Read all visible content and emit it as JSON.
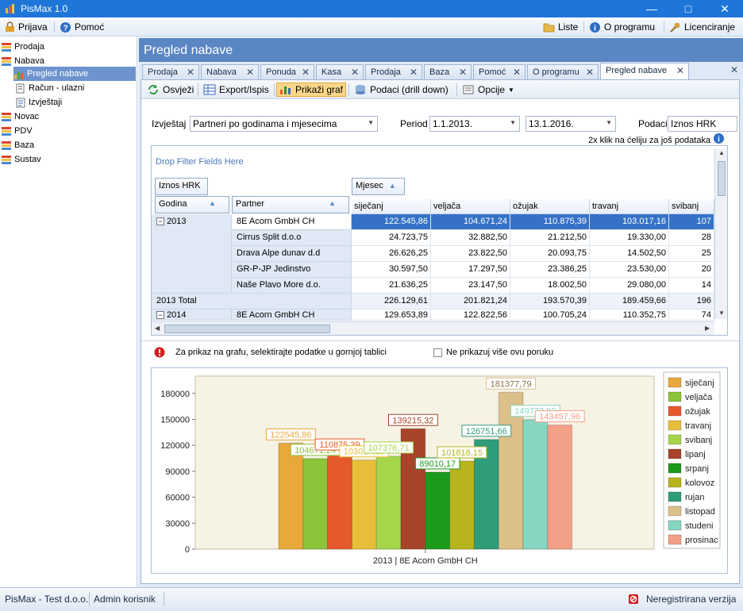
{
  "window": {
    "title": "PisMax 1.0"
  },
  "menu": {
    "prijava": "Prijava",
    "pomoc": "Pomoć",
    "liste": "Liste",
    "o_programu": "O programu",
    "licenciranje": "Licenciranje"
  },
  "nav": [
    {
      "label": "Prodaja",
      "level": 0
    },
    {
      "label": "Nabava",
      "level": 0
    },
    {
      "label": "Pregled nabave",
      "level": 1,
      "selected": true
    },
    {
      "label": "Račun - ulazni",
      "level": 1
    },
    {
      "label": "Izvještaji",
      "level": 1
    },
    {
      "label": "Novac",
      "level": 0
    },
    {
      "label": "PDV",
      "level": 0
    },
    {
      "label": "Baza",
      "level": 0
    },
    {
      "label": "Sustav",
      "level": 0
    }
  ],
  "panel": {
    "title": "Pregled nabave"
  },
  "tabs": [
    "Prodaja",
    "Nabava",
    "Ponuda",
    "Kasa",
    "Prodaja",
    "Baza",
    "Pomoć",
    "O programu",
    "Pregled nabave"
  ],
  "toolbar": {
    "osvjezi": "Osvježi",
    "export": "Export/Ispis",
    "graf": "Prikaži graf",
    "drill": "Podaci (drill down)",
    "opcije": "Opcije"
  },
  "filters": {
    "izvjestaj_label": "Izvještaj",
    "izvjestaj_value": "Partneri po godinama i mjesecima",
    "period_label": "Period",
    "period_from": "1.1.2013.",
    "period_to": "13.1.2016.",
    "podaci_label": "Podaci",
    "podaci_value": "Iznos HRK",
    "hint": "2x klik na ćeliju za još podataka"
  },
  "pivot": {
    "drop_filter": "Drop Filter Fields Here",
    "data_field": "Iznos HRK",
    "column_field": "Mjesec",
    "row_fields": [
      "Godina",
      "Partner"
    ],
    "months": [
      "siječanj",
      "veljača",
      "ožujak",
      "travanj",
      "svibanj"
    ],
    "rows": [
      {
        "year": "2013",
        "partner": "8E Acorn GmbH CH",
        "values": [
          "122.545,86",
          "104.671,24",
          "110.875,39",
          "103.017,16",
          "107"
        ]
      },
      {
        "partner": "Cirrus Split d.o.o",
        "values": [
          "24.723,75",
          "32.882,50",
          "21.212,50",
          "19.330,00",
          "28"
        ]
      },
      {
        "partner": "Drava Alpe dunav d.d",
        "values": [
          "26.626,25",
          "23.822,50",
          "20.093,75",
          "14.502,50",
          "25"
        ]
      },
      {
        "partner": "GR-P-JP Jedinstvo",
        "values": [
          "30.597,50",
          "17.297,50",
          "23.386,25",
          "23.530,00",
          "20"
        ]
      },
      {
        "partner": "Naše Plavo More d.o.",
        "values": [
          "21.636,25",
          "23.147,50",
          "18.002,50",
          "29.080,00",
          "14"
        ]
      }
    ],
    "total": {
      "label": "2013 Total",
      "values": [
        "226.129,61",
        "201.821,24",
        "193.570,39",
        "189.459,66",
        "196"
      ]
    },
    "next": {
      "year": "2014",
      "partner": "8E Acorn GmbH CH",
      "values": [
        "129.653,89",
        "122.822,56",
        "100.705,24",
        "110.352,75",
        "74"
      ]
    }
  },
  "message": {
    "text": "Za prikaz na grafu, selektirajte podatke u gornjoj tablici",
    "checkbox": "Ne prikazuj više ovu poruku"
  },
  "chart_data": {
    "type": "bar",
    "categories": [
      "2013 | 8E Acorn GmbH CH"
    ],
    "series": [
      {
        "name": "siječanj",
        "value": 122545.86,
        "label": "122545,86",
        "color": "#e9a83a"
      },
      {
        "name": "veljača",
        "value": 104671.24,
        "label": "104671,24",
        "color": "#8cc43a"
      },
      {
        "name": "ožujak",
        "value": 110875.39,
        "label": "110875,39",
        "color": "#e5592c"
      },
      {
        "name": "travanj",
        "value": 103017.16,
        "label": "103017,16",
        "color": "#e8bf3a"
      },
      {
        "name": "svibanj",
        "value": 107376.71,
        "label": "107376,71",
        "color": "#a5d64a"
      },
      {
        "name": "lipanj",
        "value": 139215.32,
        "label": "139215,32",
        "color": "#a8442a"
      },
      {
        "name": "srpanj",
        "value": 89010.17,
        "label": "89010,17",
        "color": "#1c9a1c"
      },
      {
        "name": "kolovoz",
        "value": 101818.15,
        "label": "101818,15",
        "color": "#b8b41e"
      },
      {
        "name": "rujan",
        "value": 126751.66,
        "label": "126751,66",
        "color": "#2f9c7a"
      },
      {
        "name": "listopad",
        "value": 181377.79,
        "label": "181377,79",
        "color": "#dcc08a"
      },
      {
        "name": "studeni",
        "value": 149772.82,
        "label": "149772,82",
        "color": "#86d6c2"
      },
      {
        "name": "prosinac",
        "value": 143457.96,
        "label": "143457,96",
        "color": "#f3a088"
      }
    ],
    "yticks": [
      "0",
      "30000",
      "60000",
      "90000",
      "120000",
      "150000",
      "180000"
    ],
    "ylim": [
      0,
      200000
    ],
    "legend": "right"
  },
  "status": {
    "company": "PisMax - Test d.o.o.",
    "user": "Admin korisnik",
    "license": "Neregistrirana verzija"
  }
}
